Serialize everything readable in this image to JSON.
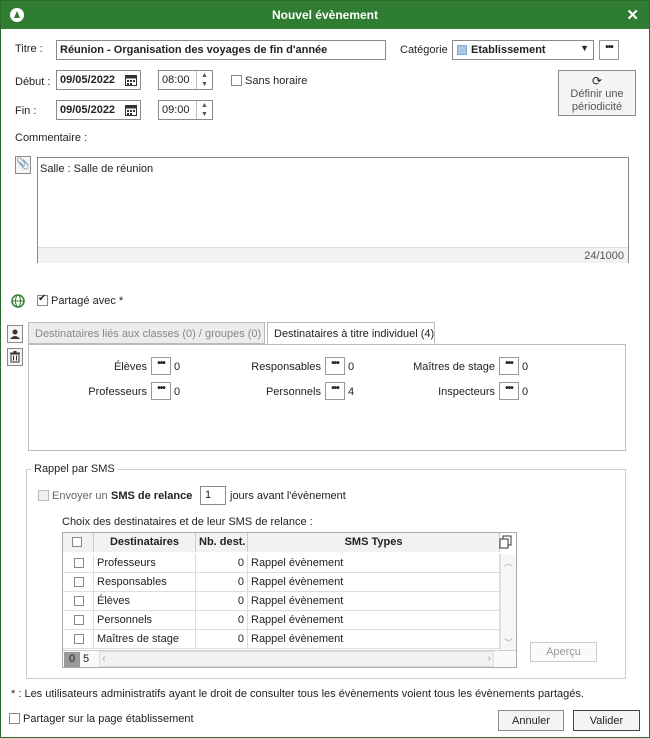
{
  "window": {
    "title": "Nouvel évènement",
    "close": "✕"
  },
  "form": {
    "title_label": "Titre :",
    "title_value": "Réunion - Organisation des voyages de fin d'année",
    "category_label": "Catégorie",
    "category_value": "Etablissement",
    "category_color": "#a8c8e8",
    "start_label": "Début :",
    "start_date": "09/05/2022",
    "start_time": "08:00",
    "no_time_label": "Sans horaire",
    "end_label": "Fin :",
    "end_date": "09/05/2022",
    "end_time": "09:00",
    "periodicity_label": "Définir une périodicité",
    "comment_label": "Commentaire :",
    "comment_value": "Salle : Salle de réunion",
    "comment_count": "24/1000",
    "shared_label": "Partagé avec *"
  },
  "tabs": [
    {
      "label": "Destinataires liés aux classes (0) / groupes (0)"
    },
    {
      "label": "Destinataires à titre individuel (4)"
    }
  ],
  "recipients": [
    {
      "label": "Élèves",
      "count": "0"
    },
    {
      "label": "Responsables",
      "count": "0"
    },
    {
      "label": "Maîtres de stage",
      "count": "0"
    },
    {
      "label": "Professeurs",
      "count": "0"
    },
    {
      "label": "Personnels",
      "count": "4"
    },
    {
      "label": "Inspecteurs",
      "count": "0"
    }
  ],
  "sms": {
    "section_label": "Rappel par SMS",
    "send_prefix": "Envoyer un",
    "send_bold": "SMS de relance",
    "days_value": "1",
    "send_suffix": "jours avant l'évènement",
    "choice_label": "Choix des destinataires et de leur SMS de relance :",
    "columns": [
      "Destinataires",
      "Nb. dest.",
      "SMS Types"
    ],
    "rows": [
      {
        "name": "Professeurs",
        "count": "0",
        "type": "Rappel évènement"
      },
      {
        "name": "Responsables",
        "count": "0",
        "type": "Rappel évènement"
      },
      {
        "name": "Élèves",
        "count": "0",
        "type": "Rappel évènement"
      },
      {
        "name": "Personnels",
        "count": "0",
        "type": "Rappel évènement"
      },
      {
        "name": "Maîtres de stage",
        "count": "0",
        "type": "Rappel évènement"
      }
    ],
    "footer_selected": "0",
    "footer_total": "5",
    "preview_label": "Aperçu"
  },
  "footnote": "* : Les utilisateurs administratifs ayant le droit de consulter tous les évènements voient tous les évènements partagés.",
  "share_page_label": "Partager sur la page établissement",
  "buttons": {
    "cancel": "Annuler",
    "validate": "Valider"
  },
  "colors": {
    "titlebar": "#2f7d32"
  }
}
